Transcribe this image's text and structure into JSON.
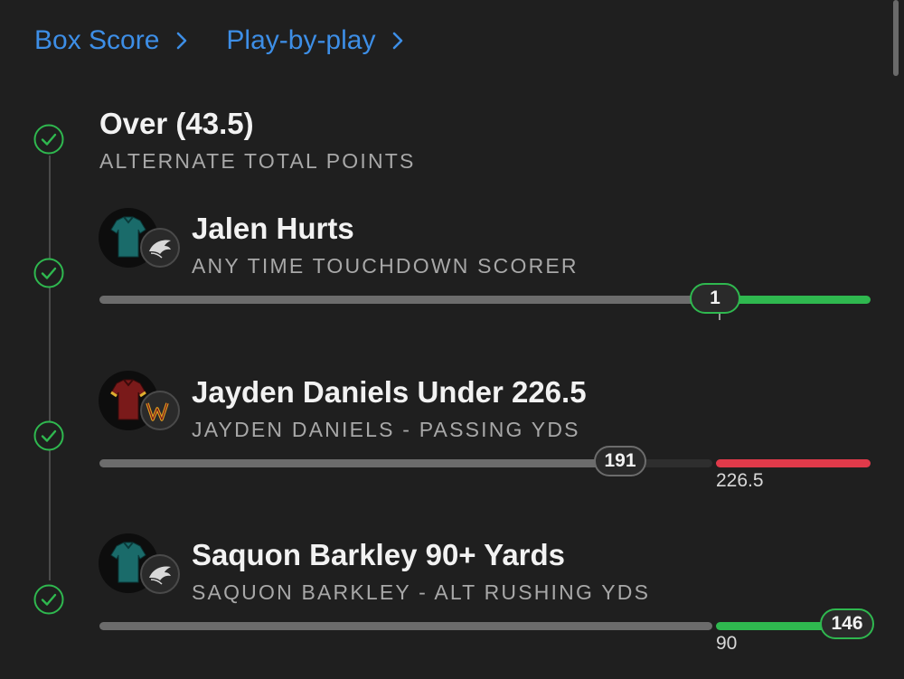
{
  "nav": {
    "box_score": "Box Score",
    "play_by_play": "Play-by-play"
  },
  "colors": {
    "accent": "#3d8ee6",
    "win": "#2fb84f",
    "loss": "#e03a4a",
    "track": "#6c6c6c"
  },
  "legs": [
    {
      "title": "Over (43.5)",
      "subtitle": "ALTERNATE TOTAL POINTS",
      "status": "won"
    },
    {
      "title": "Jalen Hurts",
      "subtitle": "ANY TIME TOUCHDOWN SCORER",
      "status": "won",
      "team_icon": "eagles-logo-icon",
      "jersey_color": "#1a6b6a",
      "current": "1",
      "target_tick": ""
    },
    {
      "title": "Jayden Daniels Under 226.5",
      "subtitle": "JAYDEN DANIELS - PASSING YDS",
      "status": "won",
      "team_icon": "commanders-logo-icon",
      "jersey_color": "#7a1a1a",
      "current": "191",
      "target_tick": "226.5"
    },
    {
      "title": "Saquon Barkley 90+ Yards",
      "subtitle": "SAQUON BARKLEY - ALT RUSHING YDS",
      "status": "won",
      "team_icon": "eagles-logo-icon",
      "jersey_color": "#1a6b6a",
      "current": "146",
      "target_tick": "90"
    }
  ]
}
